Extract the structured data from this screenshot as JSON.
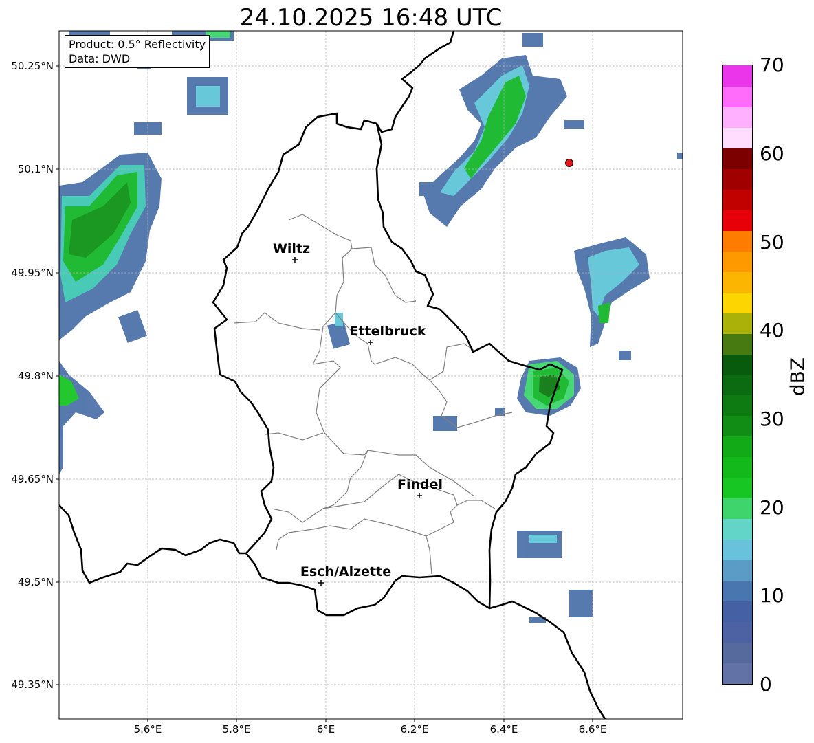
{
  "title": "24.10.2025 16:48 UTC",
  "info": {
    "product": "Product: 0.5° Reflectivity",
    "data": "Data: DWD"
  },
  "lat_ticks": [
    "50.25°N",
    "50.1°N",
    "49.95°N",
    "49.8°N",
    "49.65°N",
    "49.5°N",
    "49.35°N"
  ],
  "lon_ticks": [
    "5.6°E",
    "5.8°E",
    "6°E",
    "6.2°E",
    "6.4°E",
    "6.6°E"
  ],
  "cities": [
    {
      "name": "Wiltz",
      "lat": 49.97,
      "lon": 5.93
    },
    {
      "name": "Ettelbruck",
      "lat": 49.85,
      "lon": 6.1
    },
    {
      "name": "Findel",
      "lat": 49.63,
      "lon": 6.21
    },
    {
      "name": "Esch/Alzette",
      "lat": 49.5,
      "lon": 5.99
    }
  ],
  "radar_marker": {
    "lat": 50.11,
    "lon": 6.55,
    "color": "#e8141c"
  },
  "colorbar": {
    "unit": "dBZ",
    "labels": [
      "0",
      "10",
      "20",
      "30",
      "40",
      "50",
      "60",
      "70"
    ],
    "min": 0,
    "max": 70,
    "step": 2.5,
    "colors": [
      "#6372a6",
      "#576a9e",
      "#4c62a2",
      "#4661a3",
      "#4a76af",
      "#5b9cc6",
      "#68c2dc",
      "#63d5c8",
      "#3ed56d",
      "#17c622",
      "#13b91b",
      "#12ab17",
      "#118c14",
      "#0e7a12",
      "#0a6b10",
      "#085a0c",
      "#477a11",
      "#aab109",
      "#fdd500",
      "#fcb501",
      "#fe9a00",
      "#fe7c00",
      "#e70008",
      "#c10000",
      "#a10000",
      "#7d0000",
      "#ffddff",
      "#ffb1ff",
      "#ff6cfb",
      "#ea35ea"
    ]
  },
  "map_extent": {
    "lon_min": 5.4,
    "lon_max": 6.8,
    "lat_min": 49.3,
    "lat_max": 50.3
  },
  "colors": {
    "border_country": "#000000",
    "border_canton": "#808080",
    "grid": "#b0b0b0"
  }
}
